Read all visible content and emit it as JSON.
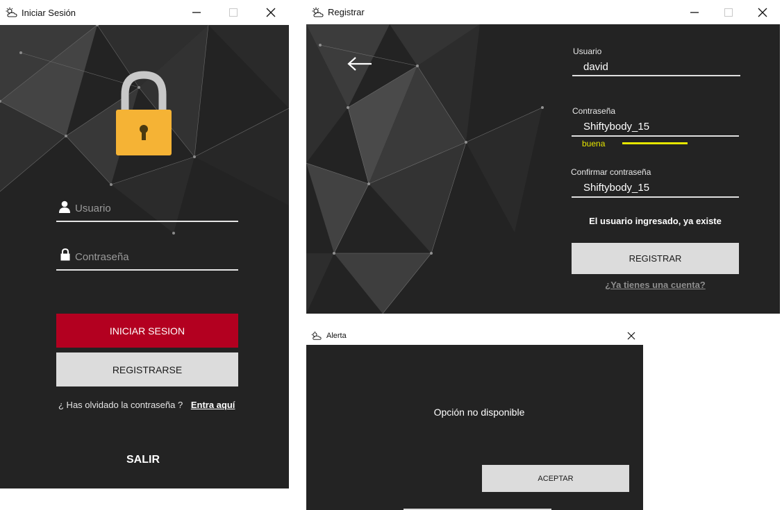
{
  "login": {
    "title": "Iniciar Sesión",
    "username_placeholder": "Usuario",
    "password_placeholder": "Contraseña",
    "login_button": "INICIAR SESION",
    "register_button": "REGISTRARSE",
    "forgot_text": "¿ Has olvidado la contraseña ?",
    "forgot_link": "Entra aquí",
    "exit_label": "SALIR"
  },
  "register": {
    "title": "Registrar",
    "username_label": "Usuario",
    "username_value": "david",
    "password_label": "Contraseña",
    "password_value": "Shiftybody_15",
    "strength_label": "buena",
    "strength_fraction": 0.5,
    "confirm_label": "Confirmar contraseña",
    "confirm_value": "Shiftybody_15",
    "error_message": "El usuario ingresado, ya existe",
    "register_button": "REGISTRAR",
    "have_account_link": "¿Ya tienes una cuenta?"
  },
  "alert": {
    "title": "Alerta",
    "message": "Opción no disponible",
    "accept_button": "ACEPTAR"
  },
  "colors": {
    "background": "#232323",
    "login_button": "#b30020",
    "secondary_button": "#dcdcdc",
    "strength_bar": "#e6e600",
    "lock_body": "#f5b335"
  },
  "icons": {
    "app": "cloud-sun-icon",
    "minimize": "minimize-icon",
    "maximize": "maximize-icon",
    "close": "close-icon",
    "lock": "padlock-icon",
    "user": "user-icon",
    "password": "lock-icon",
    "back": "arrow-left-icon"
  }
}
